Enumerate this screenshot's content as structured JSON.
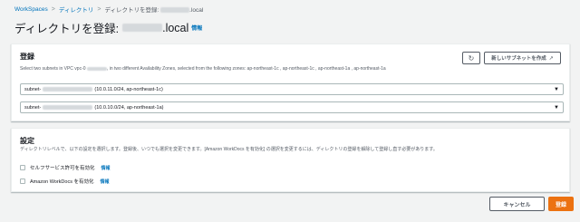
{
  "breadcrumb": {
    "items": [
      "WorkSpaces",
      "ディレクトリ"
    ],
    "current_prefix": "ディレクトリを登録:",
    "current_suffix": ".local",
    "separator": ">"
  },
  "title": {
    "prefix": "ディレクトリを登録:",
    "suffix": ".local",
    "info": "情報"
  },
  "registration": {
    "heading": "登録",
    "description_a": "Select two subnets in VPC vpc-0",
    "description_b": "in two different Availability Zones, selected from the following zones: ap-northeast-1c , ap-northeast-1c , ap-northeast-1a , ap-northeast-1a",
    "refresh_icon": "refresh-icon",
    "create_subnet_label": "新しいサブネットを作成",
    "external_icon": "external-link-icon",
    "subnets": [
      {
        "prefix": "subnet-",
        "detail": "(10.0.11.0/24, ap-northeast-1c)"
      },
      {
        "prefix": "subnet-",
        "detail": "(10.0.10.0/24, ap-northeast-1a)"
      }
    ],
    "caret": "▼"
  },
  "settings": {
    "heading": "設定",
    "description": "ディレクトリレベルで、以下の設定を選択します。登録後、いつでも選択を変更できます。[Amazon WorkDocs を有効化] の選択を変更するには、ディレクトリの登録を解除して登録し直す必要があります。",
    "options": [
      {
        "label": "セルフサービス許可を有効化",
        "info": "情報",
        "checked": false
      },
      {
        "label": "Amazon WorkDocs を有効化",
        "info": "情報",
        "checked": false
      }
    ]
  },
  "actions": {
    "cancel": "キャンセル",
    "submit": "登録"
  },
  "colors": {
    "link": "#0073bb",
    "primary_button": "#ec7211",
    "background": "#f2f3f3"
  }
}
